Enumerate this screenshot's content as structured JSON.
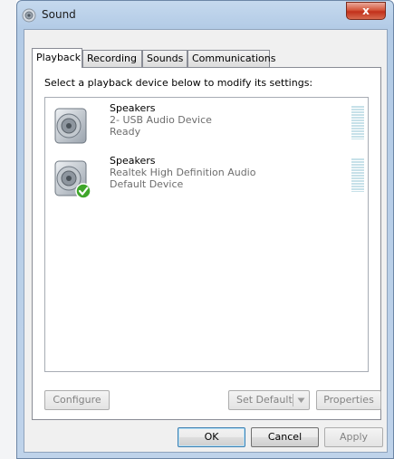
{
  "window": {
    "title": "Sound",
    "close_glyph": "x"
  },
  "tabs": [
    {
      "label": "Playback",
      "active": true
    },
    {
      "label": "Recording",
      "active": false
    },
    {
      "label": "Sounds",
      "active": false
    },
    {
      "label": "Communications",
      "active": false
    }
  ],
  "playback": {
    "instruction": "Select a playback device below to modify its settings:",
    "devices": [
      {
        "name": "Speakers",
        "description": "2- USB Audio Device",
        "status": "Ready",
        "is_default": false,
        "icon": "speaker-icon"
      },
      {
        "name": "Speakers",
        "description": "Realtek High Definition Audio",
        "status": "Default Device",
        "is_default": true,
        "icon": "speaker-icon"
      }
    ],
    "configure_label": "Configure",
    "set_default_label": "Set Default",
    "properties_label": "Properties"
  },
  "footer": {
    "ok_label": "OK",
    "cancel_label": "Cancel",
    "apply_label": "Apply"
  },
  "colors": {
    "titlebar": "#c5d9ee",
    "close_button": "#c2311b",
    "default_check": "#3fa62a",
    "level_meter": "#c7e1e9"
  }
}
